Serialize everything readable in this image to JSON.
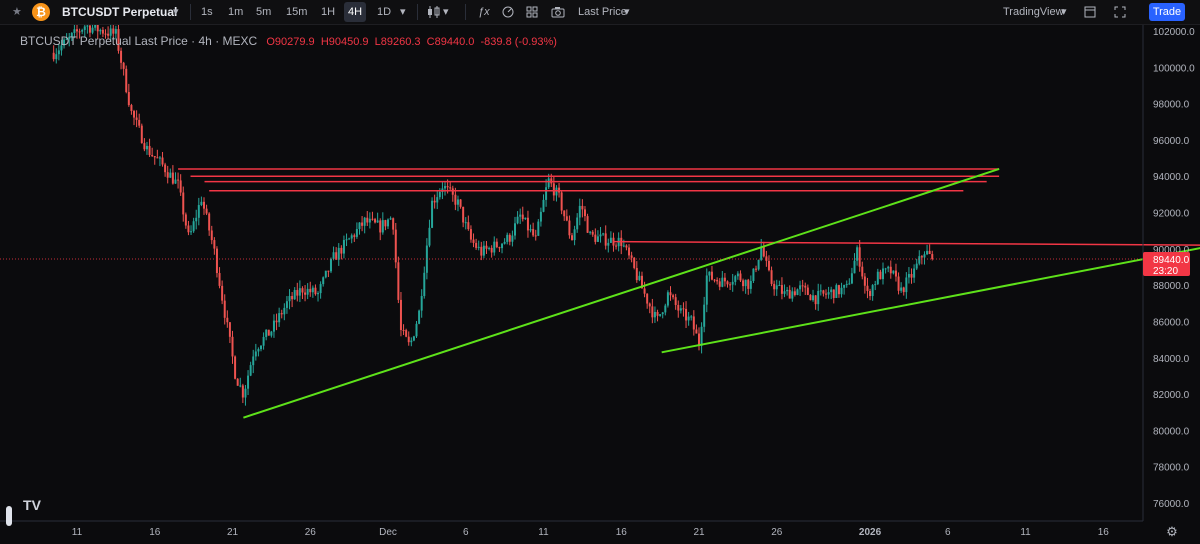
{
  "toolbar": {
    "star_icon": "star-icon",
    "coin_glyph": "₿",
    "symbol": "BTCUSDT Perpetual",
    "intervals": [
      "1s",
      "1m",
      "5m",
      "15m",
      "1H",
      "4H",
      "1D"
    ],
    "active_interval": "4H",
    "price_type": "Last Price",
    "provider": "TradingView",
    "trade_label": "Trade"
  },
  "legend": {
    "title": "BTCUSDT Perpetual Last Price · 4h · MEXC",
    "open": "O90279.9",
    "high": "H90450.9",
    "low": "L89260.3",
    "close": "C89440.0",
    "change": "-839.8 (-0.93%)"
  },
  "colors": {
    "background": "#0b0b0d",
    "up": "#26a69a",
    "down": "#ef5350",
    "trend_green": "#5ee21a",
    "level_red": "#f23645",
    "price_badge": "#f23645"
  },
  "chart_data": {
    "type": "candlestick",
    "y_ticks": [
      76000,
      78000,
      80000,
      82000,
      84000,
      86000,
      88000,
      90000,
      92000,
      94000,
      96000,
      98000,
      100000,
      102000
    ],
    "y_tick_labels": [
      "76000.0",
      "78000.0",
      "80000.0",
      "82000.0",
      "84000.0",
      "86000.0",
      "88000.0",
      "90000.0",
      "92000.0",
      "94000.0",
      "96000.0",
      "98000.0",
      "100000.0",
      "102000.0"
    ],
    "x_tick_labels": [
      "11",
      "16",
      "21",
      "26",
      "Dec",
      "6",
      "11",
      "16",
      "21",
      "26",
      "2026",
      "6",
      "11",
      "16"
    ],
    "x_tick_days": [
      0,
      5,
      10,
      15,
      20,
      25,
      30,
      35,
      40,
      45,
      51,
      56,
      61,
      66
    ],
    "x_axis_note": "day offsets from Nov 11",
    "ylim": [
      74900,
      103200
    ],
    "close_path": [
      [
        -1.5,
        100800
      ],
      [
        0.5,
        102300
      ],
      [
        2.5,
        101800
      ],
      [
        3.5,
        97500
      ],
      [
        4.5,
        95500
      ],
      [
        5.5,
        94600
      ],
      [
        6.5,
        93500
      ],
      [
        7.2,
        90500
      ],
      [
        8,
        92800
      ],
      [
        8.8,
        90000
      ],
      [
        9.5,
        86500
      ],
      [
        10.2,
        83000
      ],
      [
        10.7,
        82000
      ],
      [
        11.4,
        84500
      ],
      [
        12.5,
        85500
      ],
      [
        13.5,
        87000
      ],
      [
        14.5,
        87800
      ],
      [
        15.5,
        87500
      ],
      [
        16.5,
        89500
      ],
      [
        17.5,
        90500
      ],
      [
        18.5,
        91500
      ],
      [
        19.5,
        91200
      ],
      [
        20.3,
        91800
      ],
      [
        20.8,
        85500
      ],
      [
        21.4,
        84600
      ],
      [
        22,
        86500
      ],
      [
        22.8,
        92500
      ],
      [
        23.5,
        93500
      ],
      [
        24.5,
        92500
      ],
      [
        25.3,
        90500
      ],
      [
        26,
        89800
      ],
      [
        27,
        90200
      ],
      [
        27.8,
        90600
      ],
      [
        28.5,
        91800
      ],
      [
        29.5,
        90500
      ],
      [
        30.3,
        93800
      ],
      [
        31,
        92800
      ],
      [
        31.8,
        90500
      ],
      [
        32.4,
        92500
      ],
      [
        33,
        90700
      ],
      [
        34,
        90500
      ],
      [
        35,
        90400
      ],
      [
        35.5,
        89500
      ],
      [
        36.5,
        87500
      ],
      [
        37.3,
        86000
      ],
      [
        38,
        87500
      ],
      [
        38.8,
        86500
      ],
      [
        39.5,
        86000
      ],
      [
        40,
        84800
      ],
      [
        40.5,
        88500
      ],
      [
        41.5,
        88200
      ],
      [
        42.5,
        88500
      ],
      [
        43.3,
        88000
      ],
      [
        44,
        90100
      ],
      [
        44.6,
        88200
      ],
      [
        45.5,
        87500
      ],
      [
        46.5,
        87800
      ],
      [
        47.5,
        87300
      ],
      [
        48.5,
        87600
      ],
      [
        49.5,
        87800
      ],
      [
        50.2,
        89900
      ],
      [
        50.8,
        87400
      ],
      [
        51.5,
        88500
      ],
      [
        52.3,
        88800
      ],
      [
        53,
        87700
      ],
      [
        53.8,
        88700
      ],
      [
        54.5,
        89900
      ],
      [
        55,
        89440
      ]
    ],
    "last_price": 89440.0,
    "last_price_label": "89440.0",
    "countdown": "23:20",
    "trendlines_green": [
      [
        [
          10.7,
          80700
        ],
        [
          59.3,
          94400
        ]
      ],
      [
        [
          37.6,
          84300
        ],
        [
          73.2,
          90200
        ]
      ]
    ],
    "lines_red": [
      [
        [
          6.5,
          94400
        ],
        [
          59.3,
          94400
        ]
      ],
      [
        [
          7.3,
          94000
        ],
        [
          59.3,
          94000
        ]
      ],
      [
        [
          8.2,
          93700
        ],
        [
          58.5,
          93700
        ]
      ],
      [
        [
          8.5,
          93200
        ],
        [
          57,
          93200
        ]
      ],
      [
        [
          34.5,
          90400
        ],
        [
          73.2,
          90200
        ]
      ]
    ],
    "grid": false,
    "legend_position": "top-left"
  }
}
